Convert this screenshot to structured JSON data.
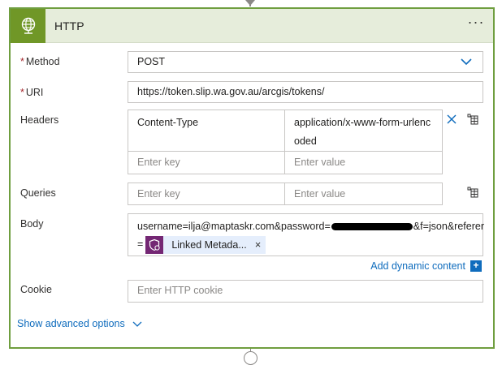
{
  "action": {
    "title": "HTTP",
    "more_label": "···",
    "icon": "globe-icon",
    "accent_color": "#709727",
    "border_color": "#6f9e3f",
    "header_bg": "#e6eddb"
  },
  "method": {
    "label": "Method",
    "required_marker": "*",
    "value": "POST"
  },
  "uri": {
    "label": "URI",
    "required_marker": "*",
    "value": "https://token.slip.wa.gov.au/arcgis/tokens/"
  },
  "headers": {
    "label": "Headers",
    "rows": [
      {
        "key": "Content-Type",
        "value_line1": "application/x-www-form-urlenc",
        "value_line2": "oded"
      }
    ],
    "key_placeholder": "Enter key",
    "value_placeholder": "Enter value"
  },
  "queries": {
    "label": "Queries",
    "key_placeholder": "Enter key",
    "value_placeholder": "Enter value"
  },
  "body": {
    "label": "Body",
    "text_before": "username=ilja@maptaskr.com&password=",
    "text_after": "&f=json&referer",
    "line2_prefix": "=",
    "token_label": "Linked Metada...",
    "token_close": "×",
    "token_icon": "shield-heart-icon",
    "token_color": "#742774"
  },
  "dynamic_content": {
    "label": "Add dynamic content",
    "plus": "+"
  },
  "cookie": {
    "label": "Cookie",
    "placeholder": "Enter HTTP cookie"
  },
  "advanced": {
    "label": "Show advanced options"
  }
}
